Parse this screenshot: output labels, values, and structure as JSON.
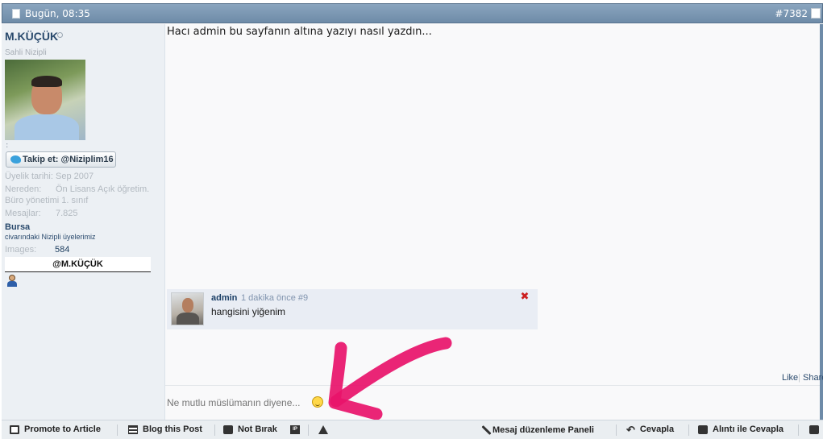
{
  "header": {
    "date": "Bugün, 08:35",
    "post_number": "#7382"
  },
  "user": {
    "name": "M.KÜÇÜK",
    "title": "Sahli Nizipli",
    "dot_line": ":",
    "twitter_button": "Takip et: @Niziplim16",
    "join_label": "Üyelik tarihi:",
    "join_value": "Sep 2007",
    "from_label": "Nereden:",
    "from_value": "Ön Lisans Açık öğretim.",
    "from_value_2": "Büro yönetimi 1. sınıf",
    "posts_label": "Mesajlar:",
    "posts_value": "7.825",
    "location": "Bursa",
    "location_sub": "civarındaki Nizipli üyelerimiz",
    "images_label": "Images:",
    "images_value": "584",
    "handle": "@M.KÜÇÜK"
  },
  "post": {
    "message": "Hacı admin bu sayfanın altına yazıyı nasıl yazdın..."
  },
  "comment": {
    "author": "admin",
    "meta": "1 dakika önce #9",
    "text": "hangisini yiğenim"
  },
  "actions": {
    "like": "Like",
    "share": "Share"
  },
  "reply": {
    "placeholder": "Ne mutlu müslümanın diyene..."
  },
  "toolbar": {
    "promote": "Promote to Article",
    "blog": "Blog this Post",
    "note": "Not Bırak",
    "ip": "IP",
    "edit_panel": "Mesaj düzenleme Paneli",
    "reply": "Cevapla",
    "quote_reply": "Alıntı ile Cevapla"
  },
  "colors": {
    "header_bar": "#7893ae",
    "accent_text": "#2a4a6d",
    "annotation_arrow": "#e8126a"
  }
}
